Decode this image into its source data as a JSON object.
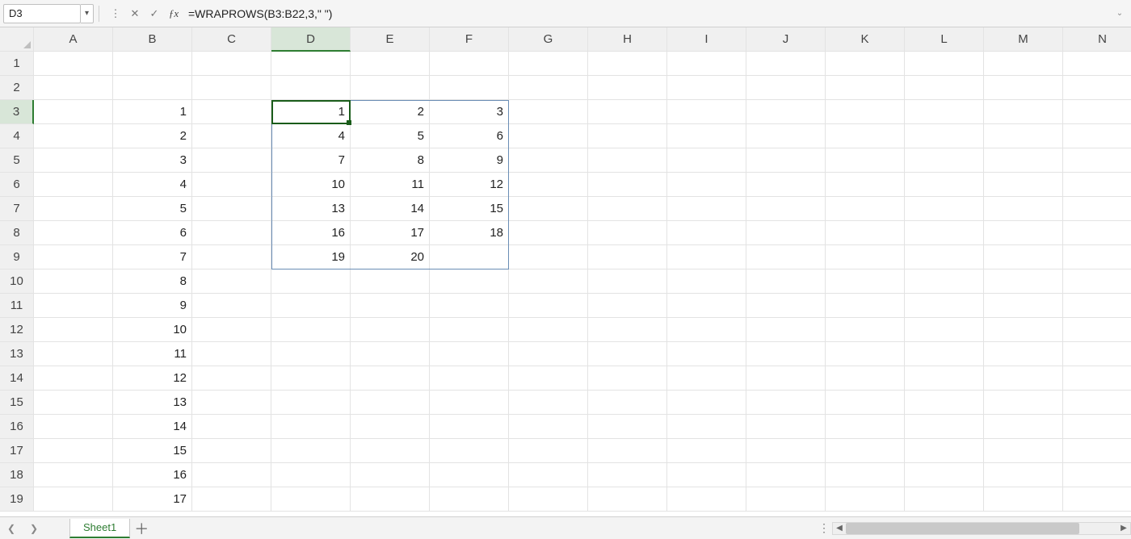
{
  "name_box": "D3",
  "formula": "=WRAPROWS(B3:B22,3,\" \")",
  "columns": [
    "A",
    "B",
    "C",
    "D",
    "E",
    "F",
    "G",
    "H",
    "I",
    "J",
    "K",
    "L",
    "M",
    "N"
  ],
  "row_count": 19,
  "active": {
    "col_index": 3,
    "row": 3
  },
  "spill_range": {
    "c1": 3,
    "r1": 3,
    "c2": 5,
    "r2": 9
  },
  "col_b": [
    "1",
    "2",
    "3",
    "4",
    "5",
    "6",
    "7",
    "8",
    "9",
    "10",
    "11",
    "12",
    "13",
    "14",
    "15",
    "16",
    "17"
  ],
  "col_b_start_row": 3,
  "wrap_block": [
    [
      "1",
      "2",
      "3"
    ],
    [
      "4",
      "5",
      "6"
    ],
    [
      "7",
      "8",
      "9"
    ],
    [
      "10",
      "11",
      "12"
    ],
    [
      "13",
      "14",
      "15"
    ],
    [
      "16",
      "17",
      "18"
    ],
    [
      "19",
      "20",
      ""
    ]
  ],
  "wrap_start": {
    "col_index": 3,
    "row": 3
  },
  "sheet_tab": "Sheet1"
}
